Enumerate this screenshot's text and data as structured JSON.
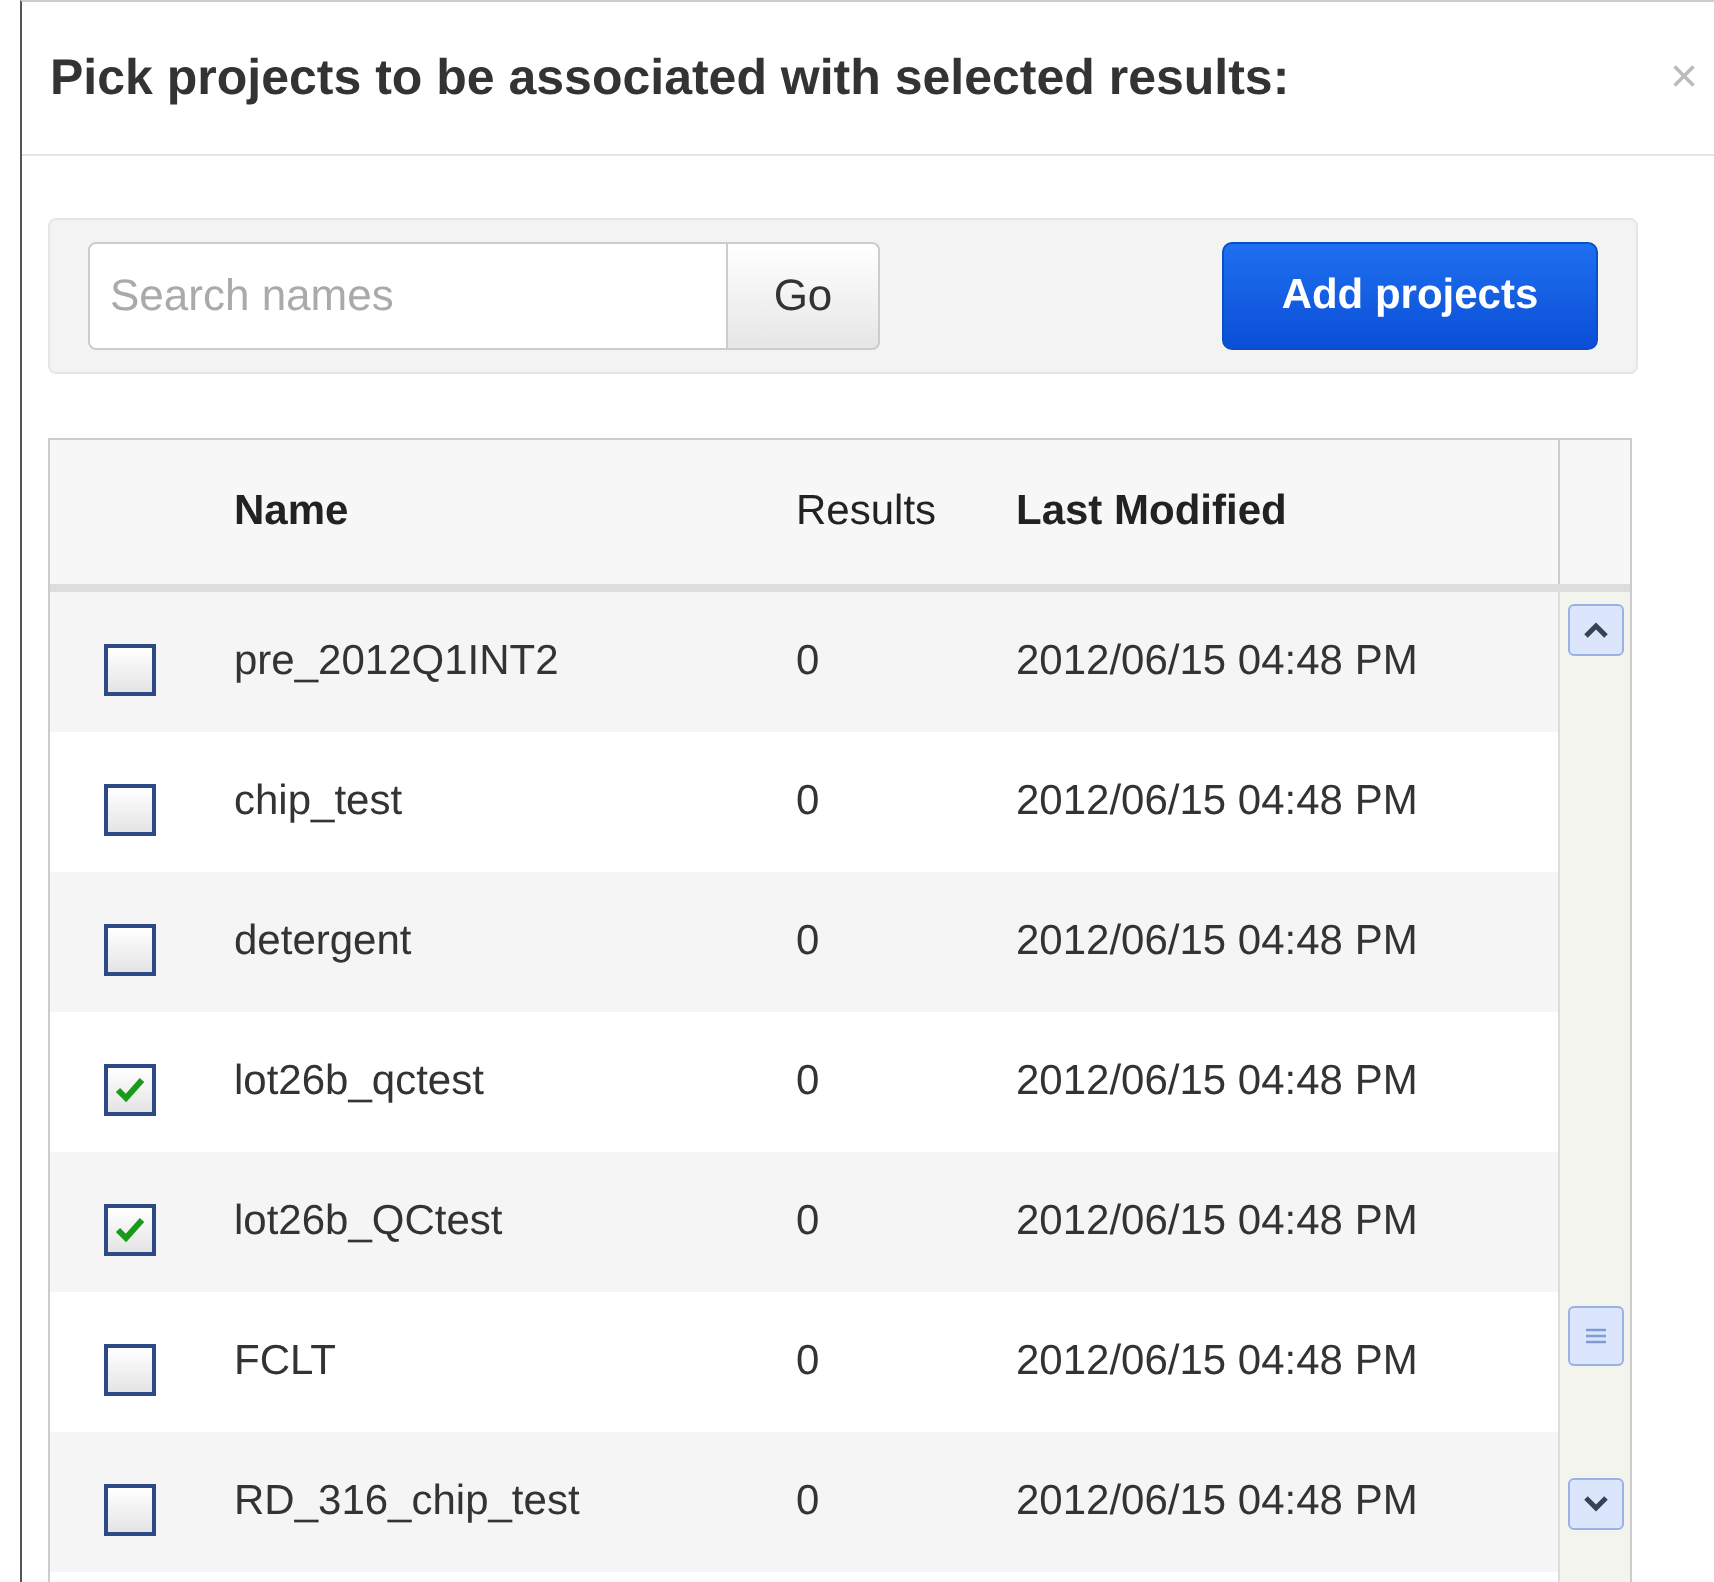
{
  "dialog": {
    "title": "Pick projects to be associated with selected results:",
    "close": "×"
  },
  "toolbar": {
    "search": {
      "placeholder": "Search names"
    },
    "go_button": "Go",
    "add_button": "Add projects"
  },
  "table": {
    "columns": [
      "Name",
      "Results",
      "Last Modified"
    ],
    "rows": [
      {
        "name": "pre_2012Q1INT2",
        "results": "0",
        "modified": "2012/06/15 04:48 PM",
        "checked": false
      },
      {
        "name": "chip_test",
        "results": "0",
        "modified": "2012/06/15 04:48 PM",
        "checked": false
      },
      {
        "name": "detergent",
        "results": "0",
        "modified": "2012/06/15 04:48 PM",
        "checked": false
      },
      {
        "name": "lot26b_qctest",
        "results": "0",
        "modified": "2012/06/15 04:48 PM",
        "checked": true
      },
      {
        "name": "lot26b_QCtest",
        "results": "0",
        "modified": "2012/06/15 04:48 PM",
        "checked": true
      },
      {
        "name": "FCLT",
        "results": "0",
        "modified": "2012/06/15 04:48 PM",
        "checked": false
      },
      {
        "name": "RD_316_chip_test",
        "results": "0",
        "modified": "2012/06/15 04:48 PM",
        "checked": false
      }
    ]
  }
}
